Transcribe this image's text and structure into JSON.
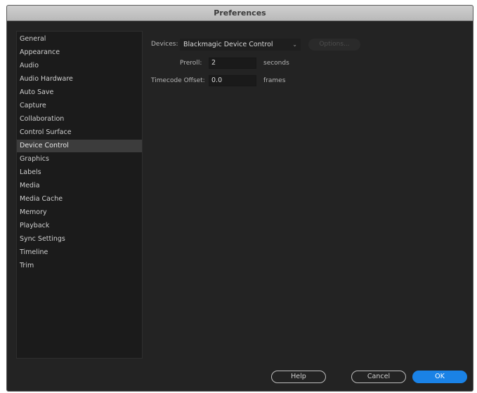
{
  "window": {
    "title": "Preferences"
  },
  "sidebar": {
    "selected_index": 8,
    "items": [
      {
        "label": "General"
      },
      {
        "label": "Appearance"
      },
      {
        "label": "Audio"
      },
      {
        "label": "Audio Hardware"
      },
      {
        "label": "Auto Save"
      },
      {
        "label": "Capture"
      },
      {
        "label": "Collaboration"
      },
      {
        "label": "Control Surface"
      },
      {
        "label": "Device Control"
      },
      {
        "label": "Graphics"
      },
      {
        "label": "Labels"
      },
      {
        "label": "Media"
      },
      {
        "label": "Media Cache"
      },
      {
        "label": "Memory"
      },
      {
        "label": "Playback"
      },
      {
        "label": "Sync Settings"
      },
      {
        "label": "Timeline"
      },
      {
        "label": "Trim"
      }
    ]
  },
  "device_control": {
    "devices_label": "Devices:",
    "devices_value": "Blackmagic Device Control",
    "options_label": "Options...",
    "preroll_label": "Preroll:",
    "preroll_value": "2",
    "preroll_unit": "seconds",
    "timecode_offset_label": "Timecode Offset:",
    "timecode_offset_value": "0.0",
    "timecode_offset_unit": "frames"
  },
  "footer": {
    "help_label": "Help",
    "cancel_label": "Cancel",
    "ok_label": "OK"
  },
  "colors": {
    "window_bg": "#232323",
    "sidebar_bg": "#1b1b1b",
    "selected_bg": "#3c3c3c",
    "accent": "#1a82e6",
    "titlebar": "#c4c4c4"
  },
  "icons": {
    "dropdown": "chevron-down-icon"
  }
}
